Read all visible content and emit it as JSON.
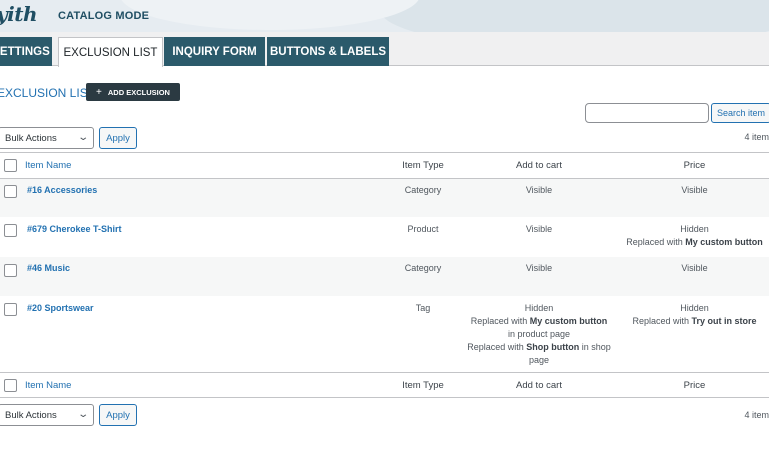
{
  "header": {
    "logo": "yith",
    "title": "CATALOG MODE"
  },
  "tabs": [
    "SETTINGS",
    "EXCLUSION LIST",
    "INQUIRY FORM",
    "BUTTONS & LABELS"
  ],
  "exclusion": {
    "title": "EXCLUSION LIST",
    "add_label": "ADD EXCLUSION"
  },
  "search": {
    "placeholder": "",
    "button": "Search item"
  },
  "bulk": {
    "selected": "Bulk Actions",
    "apply": "Apply",
    "count": "4 item"
  },
  "columns": {
    "name": "Item Name",
    "type": "Item Type",
    "cart": "Add to cart",
    "price": "Price"
  },
  "rows": [
    {
      "name": "#16 Accessories",
      "type": "Category",
      "cart": {
        "status": "Visible"
      },
      "price": {
        "status": "Visible"
      }
    },
    {
      "name": "#679 Cherokee T-Shirt",
      "type": "Product",
      "cart": {
        "status": "Visible"
      },
      "price": {
        "status": "Hidden",
        "pre": "Replaced with ",
        "bold": "My custom button"
      }
    },
    {
      "name": "#46 Music",
      "type": "Category",
      "cart": {
        "status": "Visible"
      },
      "price": {
        "status": "Visible"
      }
    },
    {
      "name": "#20 Sportswear",
      "type": "Tag",
      "cart": {
        "status": "Hidden",
        "l1_pre": "Replaced with ",
        "l1_bold": "My custom button",
        "l2": "in product page",
        "l3_pre": "Replaced with ",
        "l3_bold": "Shop button",
        "l3_post": " in shop",
        "l4": "page"
      },
      "price": {
        "status": "Hidden",
        "pre": "Replaced with ",
        "bold": "Try out in store"
      }
    }
  ]
}
